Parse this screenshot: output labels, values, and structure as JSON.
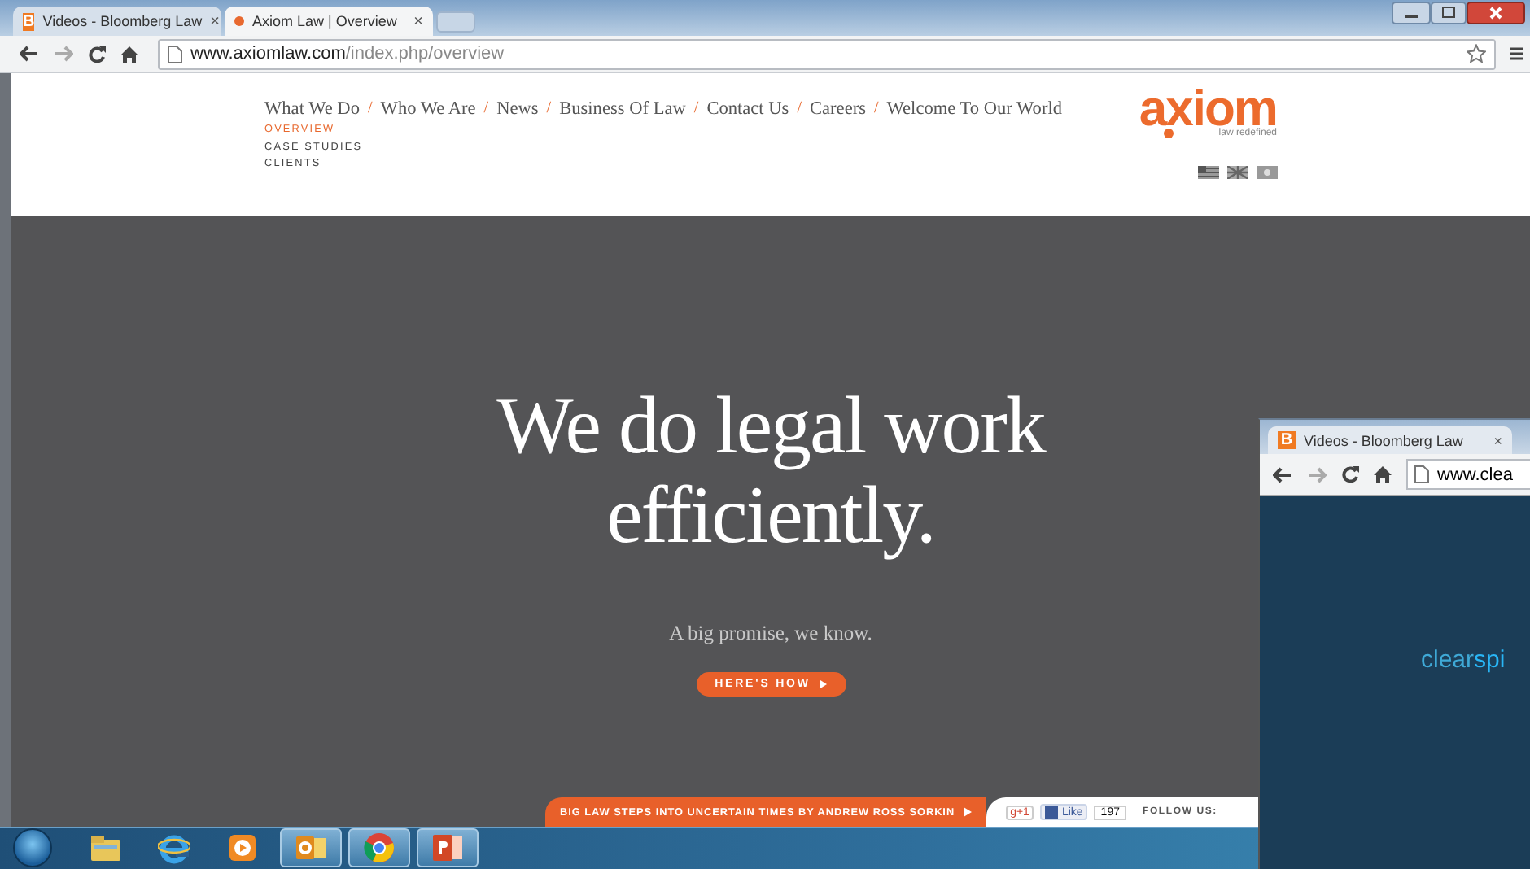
{
  "browser": {
    "tabs": [
      {
        "title": "Videos - Bloomberg Law",
        "favicon": "B",
        "close": "×",
        "selected": false
      },
      {
        "title": "Axiom Law | Overview",
        "close": "×",
        "selected": true
      }
    ],
    "url": {
      "domain": "www.axiomlaw.com",
      "path": "/index.php/overview"
    }
  },
  "site": {
    "nav": [
      {
        "label": "What We Do",
        "separator": "/"
      },
      {
        "label": "Who We Are",
        "separator": "/"
      },
      {
        "label": "News",
        "separator": "/"
      },
      {
        "label": "Business Of Law",
        "separator": "/"
      },
      {
        "label": "Contact Us",
        "separator": "/"
      },
      {
        "label": "Careers",
        "separator": "/"
      },
      {
        "label": "Welcome To Our World"
      }
    ],
    "subnav": [
      {
        "label": "OVERVIEW",
        "selected": true
      },
      {
        "label": "CASE STUDIES",
        "selected": false
      },
      {
        "label": "CLIENTS",
        "selected": false
      }
    ],
    "logo": {
      "word": "axiom",
      "tagline": "law redefined"
    }
  },
  "hero": {
    "headline": "We do legal work efficiently.",
    "subline": "A big promise, we know.",
    "button": "HERE'S HOW"
  },
  "news_bar": {
    "headline": "BIG LAW STEPS INTO UNCERTAIN TIMES BY ANDREW ROSS SORKIN",
    "gplus": "g+1",
    "like": "Like",
    "like_count": "197",
    "follow": "FOLLOW US:"
  },
  "second_window": {
    "tab": {
      "title": "Videos - Bloomberg Law",
      "favicon": "B",
      "close": "×"
    },
    "url": "www.clea",
    "logo": {
      "light": "clear",
      "bright": "spi"
    }
  },
  "taskbar": {
    "apps": [
      {
        "kind": "explorer",
        "running": false
      },
      {
        "kind": "ie",
        "running": false
      },
      {
        "kind": "media",
        "running": false
      },
      {
        "kind": "outlook",
        "running": true
      },
      {
        "kind": "chrome",
        "running": true
      },
      {
        "kind": "powerpoint",
        "running": true
      }
    ]
  }
}
